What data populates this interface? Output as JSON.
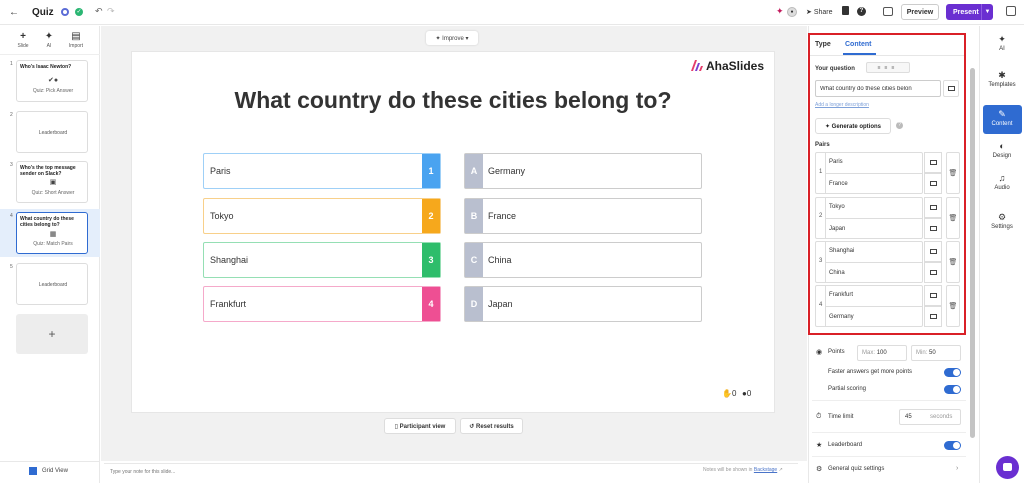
{
  "topbar": {
    "back_icon": "arrow-left-icon",
    "title": "Quiz",
    "share_label": "Share",
    "preview_label": "Preview",
    "present_label": "Present"
  },
  "left_tools": [
    {
      "icon": "plus-icon",
      "label": "Slide"
    },
    {
      "icon": "sparkle-icon",
      "label": "AI"
    },
    {
      "icon": "import-icon",
      "label": "Import"
    }
  ],
  "slides": [
    {
      "num": "1",
      "title": "Who's Isaac Newton?",
      "type": "Quiz: Pick Answer",
      "center": ""
    },
    {
      "num": "2",
      "title": "",
      "type": "",
      "center": "Leaderboard"
    },
    {
      "num": "3",
      "title": "Who's the top message sender on Slack?",
      "type": "Quiz: Short Answer",
      "center": ""
    },
    {
      "num": "4",
      "title": "What country do these cities belong to?",
      "type": "Quiz: Match Pairs",
      "center": ""
    },
    {
      "num": "5",
      "title": "",
      "type": "",
      "center": "Leaderboard"
    }
  ],
  "add_slide_label": "+",
  "grid_view_label": "Grid View",
  "canvas": {
    "improve_label": "Improve",
    "logo_text": "AhaSlides",
    "question": "What country do these cities belong to?",
    "left_items": [
      {
        "text": "Paris",
        "num": "1",
        "color": "#4aa3f0"
      },
      {
        "text": "Tokyo",
        "num": "2",
        "color": "#f6a81c"
      },
      {
        "text": "Shanghai",
        "num": "3",
        "color": "#2ebd6b"
      },
      {
        "text": "Frankfurt",
        "num": "4",
        "color": "#ee4f93"
      }
    ],
    "right_items": [
      {
        "letter": "A",
        "text": "Germany"
      },
      {
        "letter": "B",
        "text": "France"
      },
      {
        "letter": "C",
        "text": "China"
      },
      {
        "letter": "D",
        "text": "Japan"
      }
    ],
    "reactions_count": "0",
    "participants_count": "0",
    "participant_view_label": "Participant view",
    "reset_results_label": "Reset results"
  },
  "notes": {
    "placeholder": "Type your note for this slide...",
    "hint_prefix": "Notes will be shown in",
    "hint_link": "Backstage"
  },
  "panel": {
    "tab_type": "Type",
    "tab_content": "Content",
    "your_question_label": "Your question",
    "question_value": "What country do these cities belon",
    "add_description": "Add a longer description",
    "generate_label": "Generate options",
    "pairs_label": "Pairs",
    "pairs": [
      {
        "idx": "1",
        "a": "Paris",
        "b": "France"
      },
      {
        "idx": "2",
        "a": "Tokyo",
        "b": "Japan"
      },
      {
        "idx": "3",
        "a": "Shanghai",
        "b": "China"
      },
      {
        "idx": "4",
        "a": "Frankfurt",
        "b": "Germany"
      }
    ],
    "points_label": "Points",
    "max_prefix": "Max:",
    "max_value": "100",
    "min_prefix": "Min:",
    "min_value": "50",
    "faster_label": "Faster answers get more points",
    "partial_label": "Partial scoring",
    "time_label": "Time limit",
    "time_value": "45",
    "time_unit": "seconds",
    "leaderboard_label": "Leaderboard",
    "general_label": "General quiz settings"
  },
  "rail": [
    {
      "icon": "sparkle-icon",
      "label": "AI",
      "active": false
    },
    {
      "icon": "templates-icon",
      "label": "Templates",
      "active": false
    },
    {
      "icon": "pencil-icon",
      "label": "Content",
      "active": true
    },
    {
      "icon": "palette-icon",
      "label": "Design",
      "active": false
    },
    {
      "icon": "music-icon",
      "label": "Audio",
      "active": false
    },
    {
      "icon": "gear-icon",
      "label": "Settings",
      "active": false
    }
  ],
  "colors": {
    "accent": "#2f6bd1",
    "present": "#6a2fd1",
    "highlight_box": "#d92027"
  }
}
